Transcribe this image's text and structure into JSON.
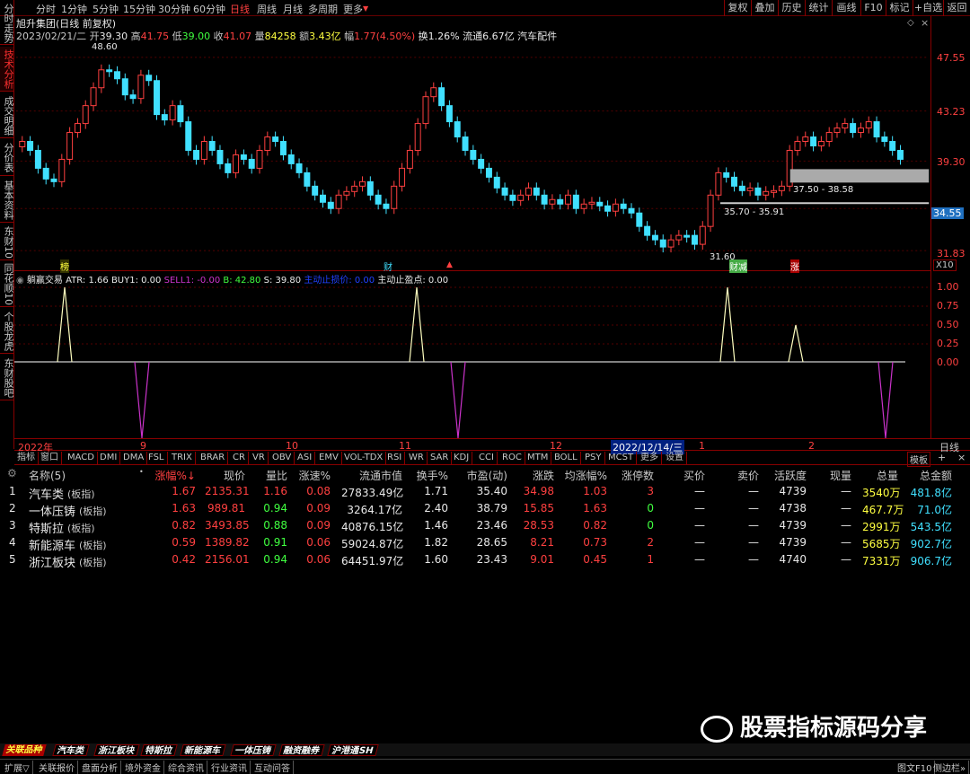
{
  "top_periods": [
    "分时",
    "1分钟",
    "5分钟",
    "15分钟",
    "30分钟",
    "60分钟",
    "日线",
    "周线",
    "月线",
    "多周期",
    "更多"
  ],
  "active_period": "日线",
  "top_buttons": [
    "复权",
    "叠加",
    "历史",
    "统计",
    "画线",
    "F10",
    "标记",
    "+自选",
    "返回"
  ],
  "left_tabs": [
    "分时走势",
    "技术分析",
    "成交明细",
    "分价表",
    "基本资料",
    "东财10",
    "同花顺10",
    "个股龙虎",
    "东财股吧"
  ],
  "stock": {
    "name_line": "旭升集团(日线 前复权)",
    "date": "2023/02/21/二",
    "open_label": "开",
    "open": "39.30",
    "high_label": "高",
    "high": "41.75",
    "low_label": "低",
    "low": "39.00",
    "close_label": "收",
    "close": "41.07",
    "vol_label": "量",
    "vol": "84258",
    "amount_label": "额",
    "amount": "3.43亿",
    "change_label": "幅",
    "change": "1.77(4.50%)",
    "turnover": "换1.26%",
    "float_cap": "流通6.67亿",
    "sector": "汽车配件"
  },
  "price_axis": [
    "47.55",
    "43.23",
    "39.30",
    "34.55",
    "31.83",
    "X10"
  ],
  "chart_annotations": {
    "high_mark": "48.60",
    "low_mark": "31.60",
    "zone1": "37.50 - 38.58",
    "zone2": "35.70 - 35.91",
    "markers": [
      "榜",
      "财",
      "财减",
      "涨"
    ]
  },
  "indicator": {
    "name": "躺赢交易",
    "atr": "ATR: 1.66",
    "buy1": "BUY1: 0.00",
    "sell1": "SELL1: -0.00",
    "b": "B: 42.80",
    "s": "S: 39.80",
    "stop_loss": "主动止损价: 0.00",
    "take_profit": "主动止盈点: 0.00",
    "axis": [
      "1.00",
      "0.75",
      "0.50",
      "0.25",
      "0.00"
    ]
  },
  "x_axis": [
    "2022年",
    "9",
    "10",
    "11",
    "12",
    "2022/12/14/三",
    "1",
    "2",
    "日线"
  ],
  "indicators_bar": [
    "指标",
    "窗口",
    "MACD",
    "DMI",
    "DMA",
    "FSL",
    "TRIX",
    "BRAR",
    "CR",
    "VR",
    "OBV",
    "ASI",
    "EMV",
    "VOL-TDX",
    "RSI",
    "WR",
    "SAR",
    "KDJ",
    "CCI",
    "ROC",
    "MTM",
    "BOLL",
    "PSY",
    "MCST",
    "更多",
    "设置"
  ],
  "template_btn": "模板",
  "table": {
    "headers": [
      "名称(5)",
      "涨幅%↓",
      "现价",
      "量比",
      "涨速%",
      "流通市值",
      "换手%",
      "市盈(动)",
      "涨跌",
      "均涨幅%",
      "涨停数",
      "买价",
      "卖价",
      "活跃度",
      "现量",
      "总量",
      "总金额"
    ],
    "rows": [
      {
        "idx": "1",
        "name": "汽车类",
        "tag": "(板指)",
        "pct": "1.67",
        "price": "2135.31",
        "vr": "1.16",
        "speed": "0.08",
        "cap": "27833.49亿",
        "turn": "1.71",
        "pe": "35.40",
        "chg": "34.98",
        "avg": "1.03",
        "lim": "3",
        "bid": "—",
        "ask": "—",
        "act": "4739",
        "cur": "—",
        "vol": "3540万",
        "amt": "481.8亿"
      },
      {
        "idx": "2",
        "name": "一体压铸",
        "tag": "(板指)",
        "pct": "1.63",
        "price": "989.81",
        "vr": "0.94",
        "speed": "0.09",
        "cap": "3264.17亿",
        "turn": "2.40",
        "pe": "38.79",
        "chg": "15.85",
        "avg": "1.63",
        "lim": "0",
        "bid": "—",
        "ask": "—",
        "act": "4738",
        "cur": "—",
        "vol": "467.7万",
        "amt": "71.0亿"
      },
      {
        "idx": "3",
        "name": "特斯拉",
        "tag": "(板指)",
        "pct": "0.82",
        "price": "3493.85",
        "vr": "0.88",
        "speed": "0.09",
        "cap": "40876.15亿",
        "turn": "1.46",
        "pe": "23.46",
        "chg": "28.53",
        "avg": "0.82",
        "lim": "0",
        "bid": "—",
        "ask": "—",
        "act": "4739",
        "cur": "—",
        "vol": "2991万",
        "amt": "543.5亿"
      },
      {
        "idx": "4",
        "name": "新能源车",
        "tag": "(板指)",
        "pct": "0.59",
        "price": "1389.82",
        "vr": "0.91",
        "speed": "0.06",
        "cap": "59024.87亿",
        "turn": "1.82",
        "pe": "28.65",
        "chg": "8.21",
        "avg": "0.73",
        "lim": "2",
        "bid": "—",
        "ask": "—",
        "act": "4739",
        "cur": "—",
        "vol": "5685万",
        "amt": "902.7亿"
      },
      {
        "idx": "5",
        "name": "浙江板块",
        "tag": "(板指)",
        "pct": "0.42",
        "price": "2156.01",
        "vr": "0.94",
        "speed": "0.06",
        "cap": "64451.97亿",
        "turn": "1.60",
        "pe": "23.43",
        "chg": "9.01",
        "avg": "0.45",
        "lim": "1",
        "bid": "—",
        "ask": "—",
        "act": "4740",
        "cur": "—",
        "vol": "7331万",
        "amt": "906.7亿"
      }
    ]
  },
  "watermark": "股票指标源码分享",
  "bottom_tabs": [
    "关联品种",
    "汽车类",
    "浙江板块",
    "特斯拉",
    "新能源车",
    "一体压铸",
    "融资融券",
    "沪港通SH"
  ],
  "status_items": [
    "扩展▽",
    "关联报价",
    "盘面分析",
    "境外资金",
    "综合资讯",
    "行业资讯",
    "互动问答"
  ],
  "status_right": [
    "图文F10",
    "侧边栏»"
  ],
  "colors": {
    "up": "#ff4040",
    "down": "#40e0ff",
    "grid": "#800000",
    "yellow": "#ffff40",
    "magenta": "#cc33cc"
  }
}
